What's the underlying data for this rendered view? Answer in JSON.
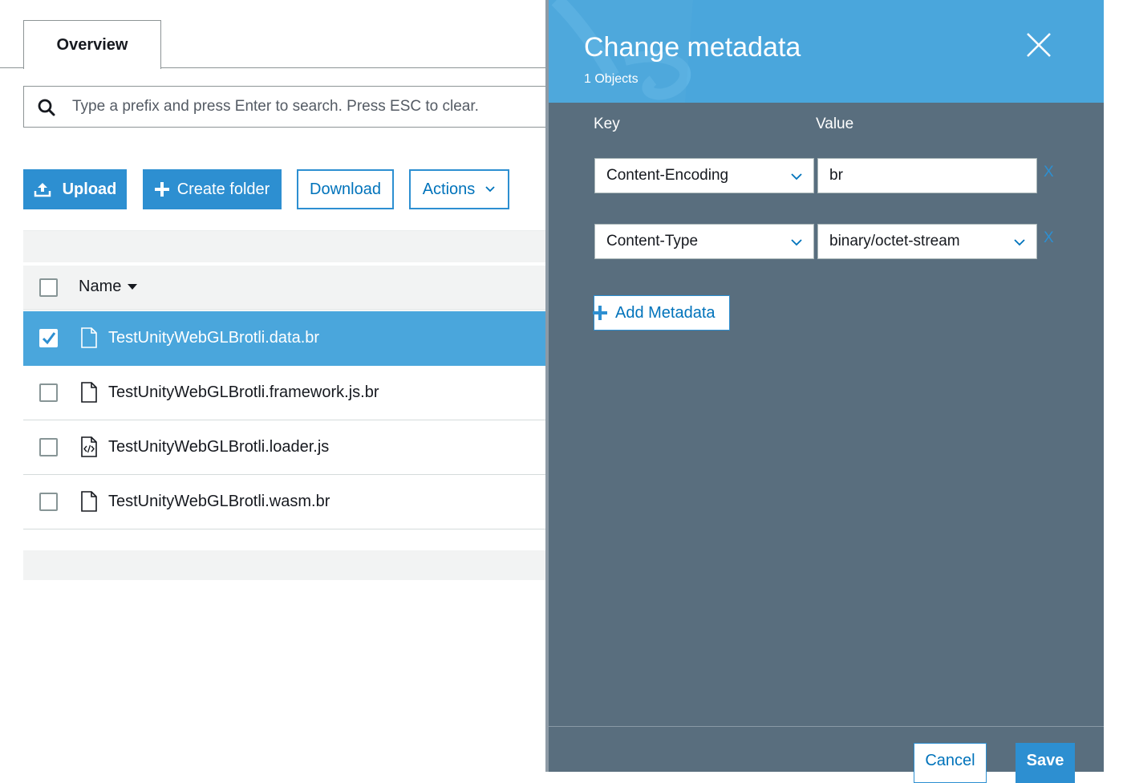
{
  "tabs": [
    {
      "label": "Overview",
      "active": true
    }
  ],
  "search": {
    "placeholder": "Type a prefix and press Enter to search. Press ESC to clear.",
    "value": ""
  },
  "toolbar": {
    "upload_label": "Upload",
    "create_folder_label": "Create folder",
    "download_label": "Download",
    "actions_label": "Actions"
  },
  "table": {
    "columns": [
      "Name"
    ],
    "rows": [
      {
        "name": "TestUnityWebGLBrotli.data.br",
        "selected": true,
        "icon": "file-icon"
      },
      {
        "name": "TestUnityWebGLBrotli.framework.js.br",
        "selected": false,
        "icon": "file-icon"
      },
      {
        "name": "TestUnityWebGLBrotli.loader.js",
        "selected": false,
        "icon": "code-file-icon"
      },
      {
        "name": "TestUnityWebGLBrotli.wasm.br",
        "selected": false,
        "icon": "file-icon"
      }
    ]
  },
  "panel": {
    "title": "Change metadata",
    "subtitle": "1 Objects",
    "key_label": "Key",
    "value_label": "Value",
    "entries": [
      {
        "key": "Content-Encoding",
        "value": "br",
        "value_is_select": false,
        "remove_label": "X"
      },
      {
        "key": "Content-Type",
        "value": "binary/octet-stream",
        "value_is_select": true,
        "remove_label": "X"
      }
    ],
    "add_label": "Add Metadata",
    "cancel_label": "Cancel",
    "save_label": "Save"
  },
  "colors": {
    "accent": "#2d8fd1",
    "selected_row": "#4aa6dc",
    "panel_header": "#4aa6dc",
    "panel_body": "#596e7e",
    "link": "#0073bb"
  }
}
